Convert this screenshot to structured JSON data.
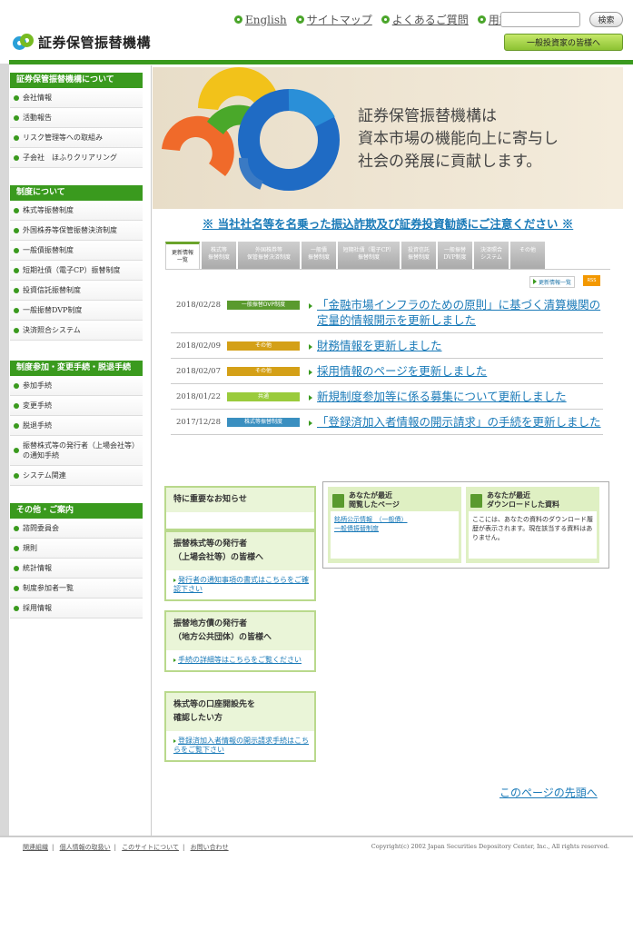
{
  "header": {
    "logo_text": "証券保管振替機構",
    "nav": [
      "English",
      "サイトマップ",
      "よくあるご質問",
      "用語集"
    ],
    "search_button": "検索",
    "investor_button": "一般投資家の皆様へ"
  },
  "sidebar": {
    "groups": [
      {
        "title": "証券保管振替機構について",
        "items": [
          "会社情報",
          "活動報告",
          "リスク管理等への取組み",
          "子会社　ほふりクリアリング"
        ]
      },
      {
        "title": "制度について",
        "items": [
          "株式等振替制度",
          "外国株券等保管振替決済制度",
          "一般債振替制度",
          "短期社債（電子CP）振替制度",
          "投資信託振替制度",
          "一般振替DVP制度",
          "決済照合システム"
        ]
      },
      {
        "title": "制度参加・変更手続・脱退手続",
        "items": [
          "参加手続",
          "変更手続",
          "脱退手続",
          "振替株式等の発行者（上場会社等）の通知手続",
          "システム関連"
        ]
      },
      {
        "title": "その他・ご案内",
        "items": [
          "諮問委員会",
          "規則",
          "統計情報",
          "制度参加者一覧",
          "採用情報"
        ]
      }
    ]
  },
  "hero": {
    "title": "証券保管振替機構は",
    "line2": "資本市場の機能向上に寄与し",
    "line3": "社会の発展に貢献します。"
  },
  "alert": "※ 当社社名等を名乗った振込詐欺及び証券投資勧誘にご注意ください ※",
  "tabs": [
    [
      "更新情報",
      "一覧"
    ],
    [
      "株式等",
      "振替制度"
    ],
    [
      "外国株券等",
      "保管振替決済制度"
    ],
    [
      "一般債",
      "振替制度"
    ],
    [
      "短期社債（電子CP）",
      "振替制度"
    ],
    [
      "投資信託",
      "振替制度"
    ],
    [
      "一般振替",
      "DVP制度"
    ],
    [
      "決済照合",
      "システム"
    ],
    [
      "その他",
      ""
    ]
  ],
  "news_list_link": "更新情報一覧",
  "rss_label": "RSS",
  "news": [
    {
      "date": "2018/02/28",
      "badge": "一般振替DVP制度",
      "badge_color": "#5a9a2e",
      "title": "「金融市場インフラのための原則」に基づく清算機関の定量的情報開示を更新しました"
    },
    {
      "date": "2018/02/09",
      "badge": "その他",
      "badge_color": "#d4a017",
      "title": "財務情報を更新しました"
    },
    {
      "date": "2018/02/07",
      "badge": "その他",
      "badge_color": "#d4a017",
      "title": "採用情報のページを更新しました"
    },
    {
      "date": "2018/01/22",
      "badge": "共通",
      "badge_color": "#9acb3c",
      "title": "新規制度参加等に係る募集について更新しました"
    },
    {
      "date": "2017/12/28",
      "badge": "株式等振替制度",
      "badge_color": "#3a8fc0",
      "title": "「登録済加入者情報の開示請求」の手続を更新しました"
    }
  ],
  "notices": {
    "important": "特に重要なお知らせ",
    "issuers_title1": "振替株式等の発行者",
    "issuers_title2": "（上場会社等）の皆様へ",
    "issuers_link": "発行者の通知事項の書式はこちらをご確認下さい",
    "local_title1": "振替地方債の発行者",
    "local_title2": "（地方公共団体）の皆様へ",
    "local_link": "手続の詳細等はこちらをご覧ください",
    "account_title1": "株式等の口座開設先を",
    "account_title2": "確認したい方",
    "account_link": "登録済加入者情報の開示請求手続はこちらをご覧下さい"
  },
  "history": {
    "pages_title1": "あなたが最近",
    "pages_title2": "閲覧したページ",
    "pages": [
      "銘柄公示情報　（一般債）",
      "一般債振替制度"
    ],
    "downloads_title1": "あなたが最近",
    "downloads_title2": "ダウンロードした資料",
    "downloads_text": "ここには、あなたの資料のダウンロード履歴が表示されます。現在該当する資料はありません。"
  },
  "pagetop": "このページの先頭へ",
  "footer": {
    "links": [
      "関連組織",
      "個人情報の取扱い",
      "このサイトについて",
      "お問い合わせ"
    ],
    "copyright": "Copyright(c) 2002 Japan Securities Depository Center, Inc., All rights reserved."
  },
  "colors": {
    "brand_green": "#3a9a1e",
    "link_blue": "#1a7ab8"
  }
}
